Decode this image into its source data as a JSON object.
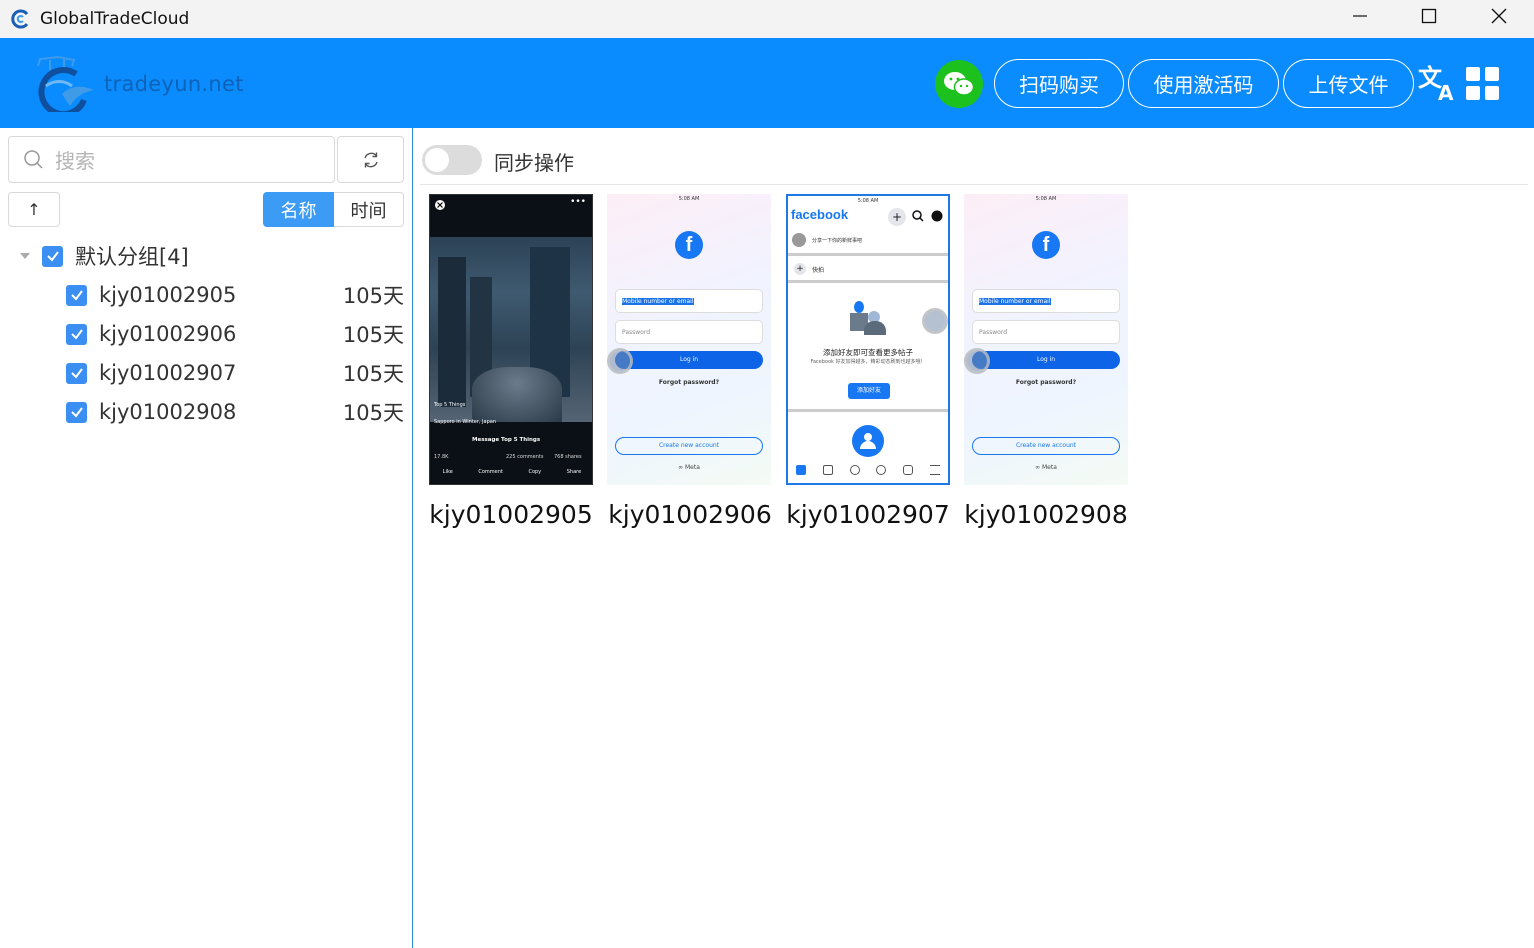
{
  "window": {
    "title": "GlobalTradeCloud",
    "minimize_glyph": "—",
    "maximize_glyph": "☐",
    "close_glyph": "✕"
  },
  "header": {
    "logo_text": "tradeyun.net",
    "buttons": {
      "scan_buy": "扫码购买",
      "activation_code": "使用激活码",
      "upload_file": "上传文件"
    },
    "colors": {
      "background": "#0a8cff",
      "wechat": "#1dc11d"
    }
  },
  "sidebar": {
    "search_placeholder": "搜索",
    "sort_glyph": "↑",
    "segments": {
      "name": "名称",
      "time": "时间",
      "active": "name"
    },
    "group": {
      "label": "默认分组[4]",
      "checked": true
    },
    "items": [
      {
        "name": "kjy01002905",
        "days": "105天",
        "checked": true
      },
      {
        "name": "kjy01002906",
        "days": "105天",
        "checked": true
      },
      {
        "name": "kjy01002907",
        "days": "105天",
        "checked": true
      },
      {
        "name": "kjy01002908",
        "days": "105天",
        "checked": true
      }
    ]
  },
  "main": {
    "sync_label": "同步操作",
    "sync_on": false,
    "devices": [
      {
        "name": "kjy01002905",
        "screen": "video",
        "time": "",
        "overlay": {
          "tag": "Top 5 Things",
          "location": "Sapporo in Winter, Japan",
          "message": "Message Top 5 Things",
          "reactions": "17.8K",
          "comments": "225 comments",
          "shares": "768 shares",
          "actions": [
            "Like",
            "Comment",
            "Copy",
            "Share"
          ]
        }
      },
      {
        "name": "kjy01002906",
        "screen": "login",
        "time": "5:08 AM",
        "login": {
          "phone_placeholder": "Mobile number or email",
          "password_placeholder": "Password",
          "login_button": "Log in",
          "forgot": "Forgot password?",
          "create": "Create new account",
          "meta": "∞ Meta"
        }
      },
      {
        "name": "kjy01002907",
        "screen": "feed",
        "time": "5:08 AM",
        "feed": {
          "brand": "facebook",
          "composer": "分享一下你的新鲜事吧",
          "reels": "快拍",
          "suggest_title": "添加好友即可查看更多帖子",
          "suggest_body": "Facebook 好友加得越多，精彩动态刷到也越多哦！",
          "add_friends": "添加好友"
        }
      },
      {
        "name": "kjy01002908",
        "screen": "login",
        "time": "5:08 AM",
        "login": {
          "phone_placeholder": "Mobile number or email",
          "password_placeholder": "Password",
          "login_button": "Log in",
          "forgot": "Forgot password?",
          "create": "Create new account",
          "meta": "∞ Meta"
        }
      }
    ]
  }
}
